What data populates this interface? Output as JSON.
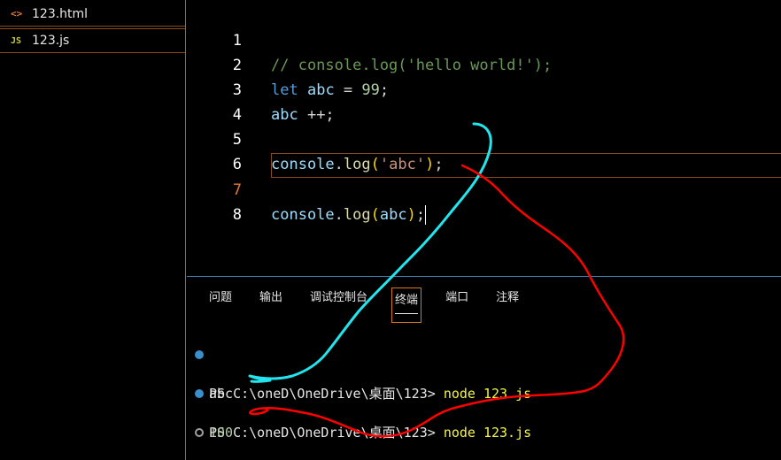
{
  "explorer": {
    "files": [
      {
        "icon": "<>",
        "name": "123.html"
      },
      {
        "icon": "JS",
        "name": "123.js"
      }
    ]
  },
  "editor": {
    "line_numbers": [
      "1",
      "2",
      "3",
      "4",
      "5",
      "6",
      "7",
      "8"
    ],
    "line1_comment": "// console.log('hello world!');",
    "line2": {
      "kw": "let",
      "var": "abc",
      "eq": " = ",
      "num": "99",
      "semi": ";"
    },
    "line3": {
      "var": "abc",
      "op": " ++;"
    },
    "line5": {
      "obj": "console",
      "dot": ".",
      "fn": "log",
      "open": "(",
      "str": "'abc'",
      "close": ")",
      "semi": ";"
    },
    "line7": {
      "obj": "console",
      "dot": ".",
      "fn": "log",
      "open": "(",
      "arg": "abc",
      "close": ")",
      "semi": ";"
    }
  },
  "panel": {
    "tabs": [
      "问题",
      "输出",
      "调试控制台",
      "终端",
      "端口",
      "注释"
    ],
    "active_tab": "终端",
    "terminal": {
      "prompt": "PS C:\\oneD\\OneDrive\\桌面\\123> ",
      "command": "node 123.js",
      "output1": "abc",
      "output2": "100"
    }
  },
  "colors": {
    "annotation_cyan": "#22e5ee",
    "annotation_red": "#ff0000",
    "accent_border": "#d4781e"
  }
}
